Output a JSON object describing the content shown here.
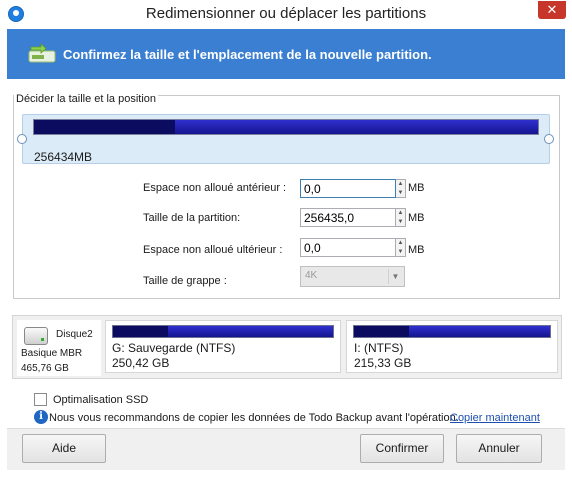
{
  "window": {
    "title": "Redimensionner ou déplacer les partitions",
    "close_label": "✕"
  },
  "banner": {
    "text": "Confirmez la taille et l'emplacement de la nouvelle partition."
  },
  "size_group": {
    "legend": "Décider la taille et la position",
    "slider_size": "256434MB",
    "slider_used_fraction": 0.28
  },
  "form": {
    "before": {
      "label": "Espace non alloué antérieur :",
      "value": "0,0",
      "unit": "MB"
    },
    "size": {
      "label": "Taille de la partition:",
      "value": "256435,0",
      "unit": "MB"
    },
    "after": {
      "label": "Espace non alloué ultérieur :",
      "value": "0,0",
      "unit": "MB"
    },
    "cluster": {
      "label": "Taille de grappe :",
      "value": "4K"
    }
  },
  "disk": {
    "name": "Disque2",
    "type": "Basique MBR",
    "size": "465,76 GB",
    "partitions": [
      {
        "name": "G: Sauvegarde (NTFS)",
        "size": "250,42 GB",
        "used_fraction": 0.25
      },
      {
        "name": "I: (NTFS)",
        "size": "215,33 GB",
        "used_fraction": 0.28
      }
    ]
  },
  "options": {
    "ssd_label": "Optimalisation SSD",
    "ssd_checked": false,
    "info_text": "Nous vous recommandons de copier les données de Todo Backup  avant l'opération.",
    "info_link": "Copier maintenant"
  },
  "buttons": {
    "help": "Aide",
    "confirm": "Confirmer",
    "cancel": "Annuler"
  },
  "colors": {
    "banner": "#3a7fd1",
    "used": "#0b0b60",
    "free": "#2424b8",
    "close": "#c7362b"
  }
}
